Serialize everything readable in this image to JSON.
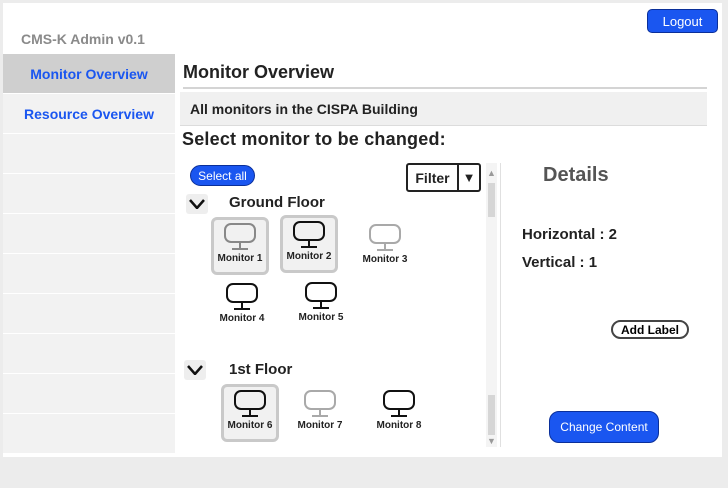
{
  "app": {
    "brand": "CMS-K Admin v0.1",
    "logout_label": "Logout"
  },
  "sidebar": {
    "items": [
      {
        "label": "Monitor Overview"
      },
      {
        "label": "Resource Overview"
      }
    ]
  },
  "main": {
    "title": "Monitor Overview",
    "banner": "All monitors in the CISPA Building",
    "prompt": "Select monitor to be changed:",
    "select_all_label": "Select all",
    "filter": {
      "label": "Filter",
      "arrow": "▼"
    }
  },
  "floors": [
    {
      "name": "Ground Floor",
      "monitors": [
        {
          "label": "Monitor 1",
          "selected": true
        },
        {
          "label": "Monitor 2",
          "selected": true
        },
        {
          "label": "Monitor 3",
          "selected": false
        },
        {
          "label": "Monitor 4",
          "selected": false
        },
        {
          "label": "Monitor 5",
          "selected": false
        }
      ]
    },
    {
      "name": "1st Floor",
      "monitors": [
        {
          "label": "Monitor 6",
          "selected": true
        },
        {
          "label": "Monitor 7",
          "selected": false
        },
        {
          "label": "Monitor 8",
          "selected": false
        }
      ]
    }
  ],
  "details": {
    "title": "Details",
    "horizontal": "Horizontal : 2",
    "vertical": "Vertical : 1",
    "add_label": "Add Label",
    "change_content": "Change Content"
  },
  "scroll": {
    "up_arrow": "▲",
    "down_arrow": "▼"
  },
  "icons": {
    "monitor": "monitor-icon",
    "collapse": "chevron-down-icon"
  },
  "colors": {
    "accent": "#1a56f0",
    "sidebar_active": "#cfcfcf"
  }
}
